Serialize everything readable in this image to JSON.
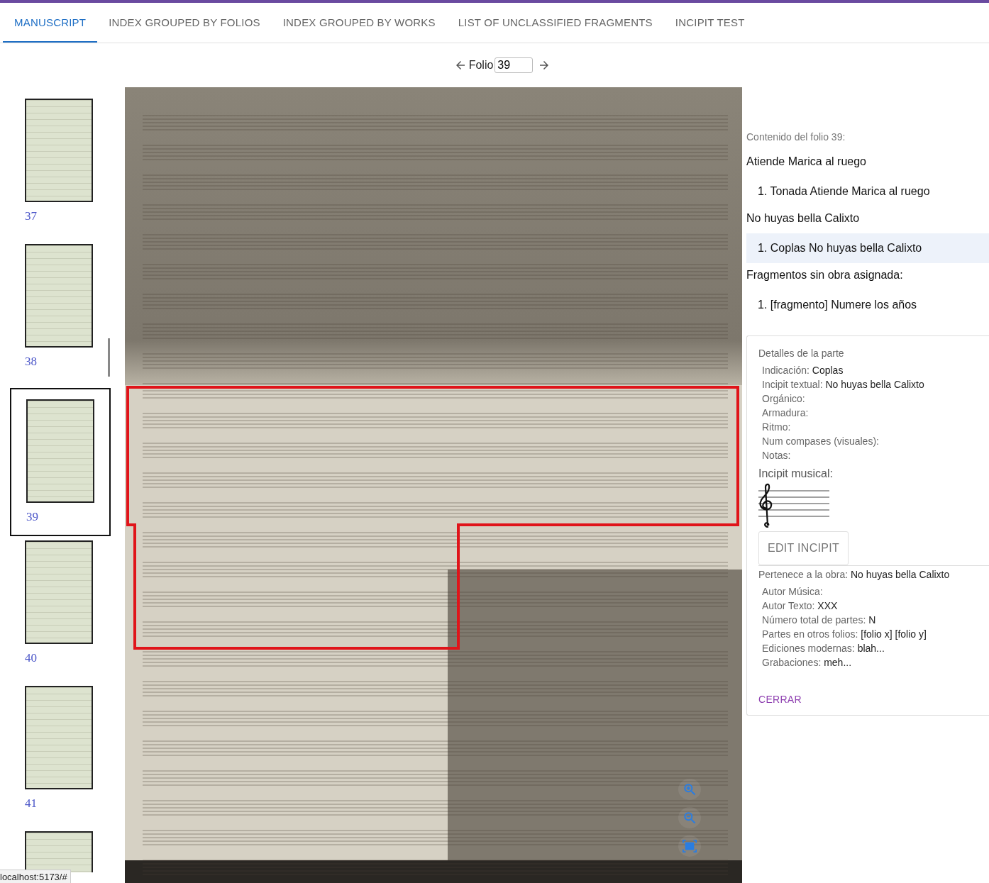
{
  "tabs": [
    {
      "label": "MANUSCRIPT",
      "selected": true
    },
    {
      "label": "INDEX GROUPED BY FOLIOS",
      "selected": false
    },
    {
      "label": "INDEX GROUPED BY WORKS",
      "selected": false
    },
    {
      "label": "LIST OF UNCLASSIFIED FRAGMENTS",
      "selected": false
    },
    {
      "label": "INCIPIT TEST",
      "selected": false
    }
  ],
  "folio_nav": {
    "label": "Folio",
    "value": "39"
  },
  "thumbnails": [
    {
      "label": "37",
      "selected": false
    },
    {
      "label": "38",
      "selected": false
    },
    {
      "label": "39",
      "selected": true
    },
    {
      "label": "40",
      "selected": false
    },
    {
      "label": "41",
      "selected": false
    },
    {
      "selected": false
    }
  ],
  "contents": {
    "heading": "Contenido del folio 39:",
    "works": [
      {
        "title": "Atiende Marica al ruego",
        "items": [
          {
            "text": "1. Tonada Atiende Marica al ruego",
            "selected": false
          }
        ]
      },
      {
        "title": "No huyas bella Calixto",
        "items": [
          {
            "text": "1. Coplas No huyas bella Calixto",
            "selected": true
          }
        ]
      }
    ],
    "fragments": {
      "title": "Fragmentos sin obra asignada:",
      "items": [
        {
          "text": "1. [fragmento] Numere los años",
          "selected": false
        }
      ]
    }
  },
  "details": {
    "title": "Detalles de la parte",
    "fields": [
      {
        "label": "Indicación:",
        "value": "Coplas"
      },
      {
        "label": "Incipit textual:",
        "value": "No huyas bella Calixto"
      },
      {
        "label": "Orgánico:"
      },
      {
        "label": "Armadura:"
      },
      {
        "label": "Ritmo:"
      },
      {
        "label": "Num compases (visuales):"
      },
      {
        "label": "Notas:"
      }
    ],
    "incipit_label": "Incipit musical:",
    "edit_button": "EDIT INCIPIT",
    "work": {
      "label": "Pertenece a la obra:",
      "value": "No huyas bella Calixto"
    },
    "work_fields": [
      {
        "label": "Autor Música:"
      },
      {
        "label": "Autor Texto:",
        "value": "XXX"
      },
      {
        "label": "Número total de partes:",
        "value": "N"
      },
      {
        "label": "Partes en otros folios:",
        "value": "[folio x] [folio y]"
      },
      {
        "label": "Ediciones modernas:",
        "value": "blah..."
      },
      {
        "label": "Grabaciones:",
        "value": "meh..."
      }
    ],
    "close_button": "CERRAR"
  },
  "status_bar": "localhost:5173/#"
}
